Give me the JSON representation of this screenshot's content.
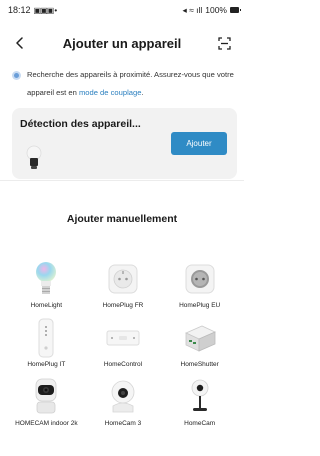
{
  "status_bar": {
    "time": "18:12",
    "app_icons": "▣▣▣ •",
    "signal_text": "◂ ≈ ıll",
    "battery": "100%"
  },
  "header": {
    "title": "Ajouter un appareil",
    "back_icon": "back-arrow-icon",
    "scan_icon": "scan-icon"
  },
  "notice": {
    "text": "Recherche des appareils à proximité. Assurez-vous que votre appareil est en ",
    "link": "mode de couplage",
    "suffix": "."
  },
  "detection": {
    "title": "Détection des appareil...",
    "add_label": "Ajouter"
  },
  "manual": {
    "title": "Ajouter manuellement"
  },
  "devices": [
    {
      "label": "HomeLight",
      "icon": "bulb-icon"
    },
    {
      "label": "HomePlug FR",
      "icon": "plug-fr-icon"
    },
    {
      "label": "HomePlug EU",
      "icon": "plug-eu-icon"
    },
    {
      "label": "HomePlug IT",
      "icon": "plug-it-icon"
    },
    {
      "label": "HomeControl",
      "icon": "ir-controller-icon"
    },
    {
      "label": "HomeShutter",
      "icon": "shutter-module-icon"
    },
    {
      "label": "HOMECAM indoor 2k",
      "icon": "indoor-camera-icon"
    },
    {
      "label": "HomeCam 3",
      "icon": "dome-camera-icon"
    },
    {
      "label": "HomeCam",
      "icon": "stand-camera-icon"
    }
  ],
  "colors": {
    "accent": "#2f8bc5",
    "link": "#2a7fbf",
    "card": "#f2f2f2"
  }
}
